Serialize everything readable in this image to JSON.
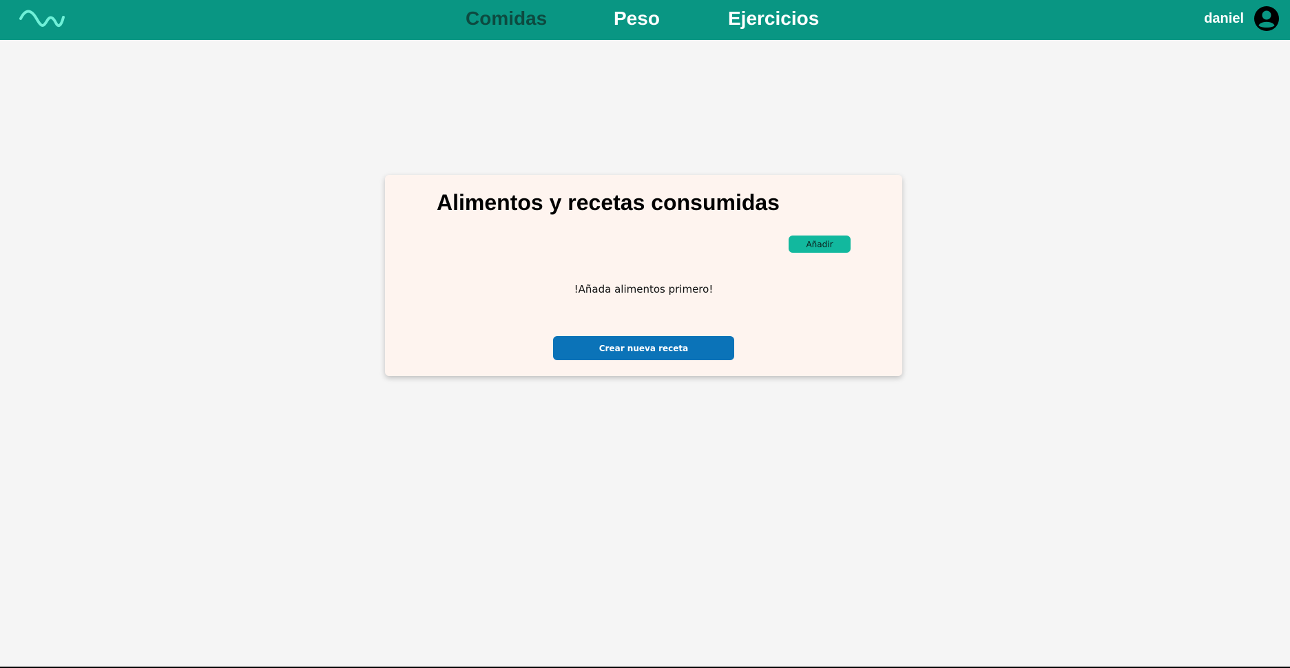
{
  "navbar": {
    "logo_icon": "wave-logo-icon",
    "links": [
      {
        "label": "Comidas",
        "active": true
      },
      {
        "label": "Peso",
        "active": false
      },
      {
        "label": "Ejercicios",
        "active": false
      }
    ],
    "user": {
      "name": "daniel",
      "avatar_icon": "user-avatar-icon"
    }
  },
  "card": {
    "title": "Alimentos y recetas consumidas",
    "add_button_label": "Añadir",
    "empty_message": "!Añada alimentos primero!",
    "create_button_label": "Crear nueva receta"
  },
  "colors": {
    "navbar_background": "#099683",
    "nav_active_text": "#0d4a40",
    "nav_text": "#ffffff",
    "logo": "#6ff0d8",
    "card_background": "#fef4ef",
    "add_button": "#12b89e",
    "create_button": "#0b73b8",
    "page_background": "#f5f5f5"
  }
}
